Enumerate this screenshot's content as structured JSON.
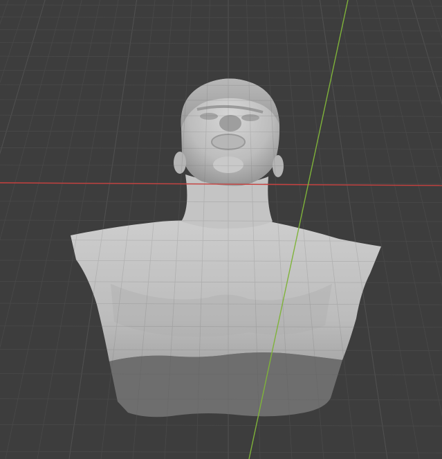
{
  "viewport": {
    "background_color": "#3d3d3d",
    "grid_color": "#4f4f4f",
    "grid_minor_color": "#474747",
    "x_axis_color": "#c9413f",
    "y_axis_color": "#7fb33a",
    "mesh_light_color": "#c8c8c8",
    "mesh_shadow_color": "#8c8c8c",
    "mesh_base_color": "#6e6e6e",
    "object": "bust-mesh"
  }
}
